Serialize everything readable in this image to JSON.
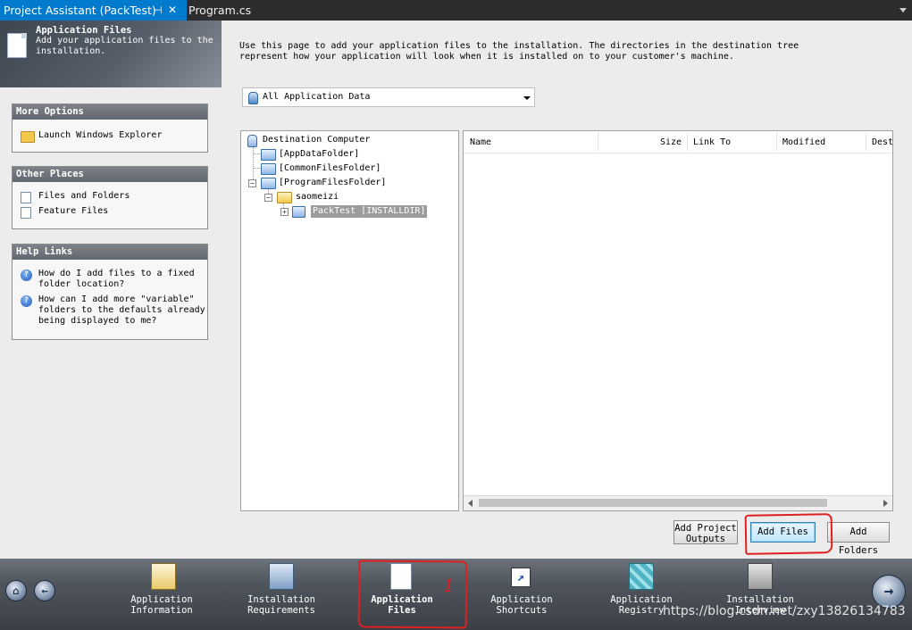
{
  "tabs": {
    "active": "Project Assistant (PackTest)",
    "pin_glyph": "⊣",
    "close_glyph": "✕",
    "second": "Program.cs"
  },
  "header": {
    "title": "Application Files",
    "description": "Add your application files to the installation."
  },
  "more_options": {
    "title": "More Options",
    "items": [
      "Launch Windows Explorer"
    ]
  },
  "other_places": {
    "title": "Other Places",
    "items": [
      "Files and Folders",
      "Feature Files"
    ]
  },
  "help_links": {
    "title": "Help Links",
    "items": [
      "How do I add files to a fixed folder location?",
      "How can I add more \"variable\" folders to the defaults already being displayed to me?"
    ]
  },
  "intro": {
    "line1": "Use this page to add your application files to the installation. The directories in the destination tree",
    "line2": "represent how your application will look when it is installed on to your customer's machine."
  },
  "data_filter": {
    "selected": "All Application Data"
  },
  "tree": {
    "root": "Destination Computer",
    "nodes": [
      "[AppDataFolder]",
      "[CommonFilesFolder]",
      "[ProgramFilesFolder]",
      "saomeizi",
      "PackTest [INSTALLDIR]"
    ]
  },
  "file_list": {
    "columns": [
      "Name",
      "Size",
      "Link To",
      "Modified",
      "Dest"
    ]
  },
  "buttons": {
    "add_project_outputs_1": "Add Project",
    "add_project_outputs_2": "Outputs",
    "add_files": "Add Files",
    "add_folders": "Add Folders"
  },
  "nav": {
    "items": [
      {
        "line1": "Application",
        "line2": "Information"
      },
      {
        "line1": "Installation",
        "line2": "Requirements"
      },
      {
        "line1": "Application",
        "line2": "Files"
      },
      {
        "line1": "Application",
        "line2": "Shortcuts"
      },
      {
        "line1": "Application",
        "line2": "Registry"
      },
      {
        "line1": "Installation",
        "line2": "Interview"
      }
    ]
  },
  "annotation": {
    "mark": "1"
  },
  "watermark": "https://blog.csdn.net/zxy13826134783",
  "colors": {
    "tab_active": "#007acc",
    "tabbar": "#2d2d30",
    "annotation_red": "#e02020",
    "selection": "#9c9c9c"
  }
}
